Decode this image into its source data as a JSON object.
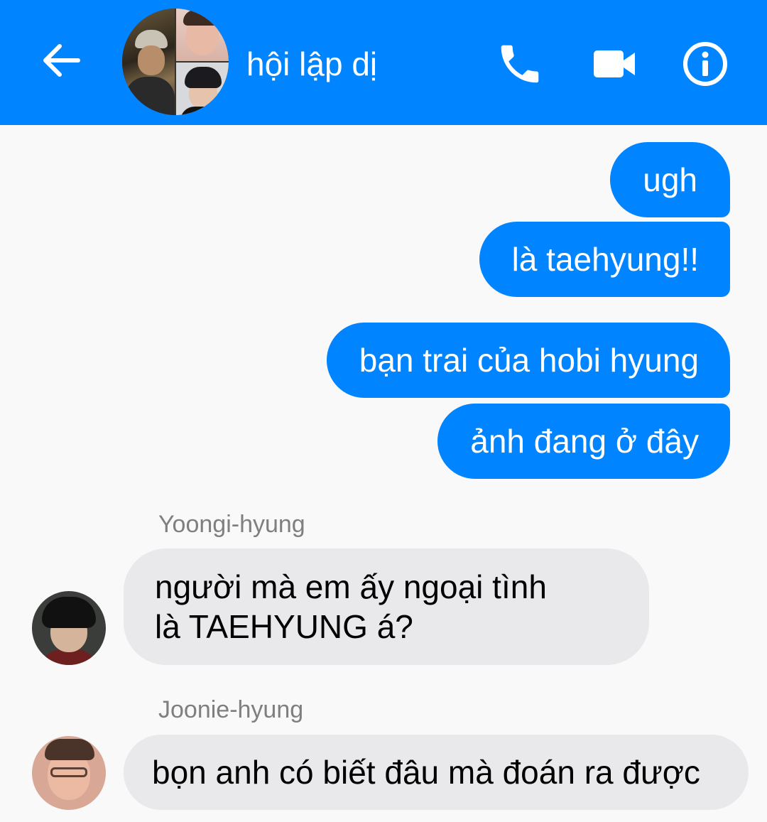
{
  "header": {
    "title": "hội lập dị",
    "back_icon": "arrow-left-icon",
    "call_icon": "phone-icon",
    "video_icon": "video-camera-icon",
    "info_icon": "info-icon",
    "background_color": "#0084ff"
  },
  "messages": {
    "outgoing": [
      {
        "text": "ugh"
      },
      {
        "text": "là taehyung!!"
      },
      {
        "text": "bạn trai của hobi hyung"
      },
      {
        "text": "ảnh đang ở đây"
      }
    ],
    "incoming": [
      {
        "sender": "Yoongi-hyung",
        "lines": [
          "người mà em ấy ngoại tình",
          "là TAEHYUNG á?"
        ]
      },
      {
        "sender": "Joonie-hyung",
        "text": "bọn anh có biết đâu mà đoán ra được"
      }
    ]
  },
  "colors": {
    "outgoing_bubble": "#0084ff",
    "incoming_bubble": "#e9e9eb",
    "sender_name": "#7f7f7f",
    "background": "#f9f9f9"
  }
}
